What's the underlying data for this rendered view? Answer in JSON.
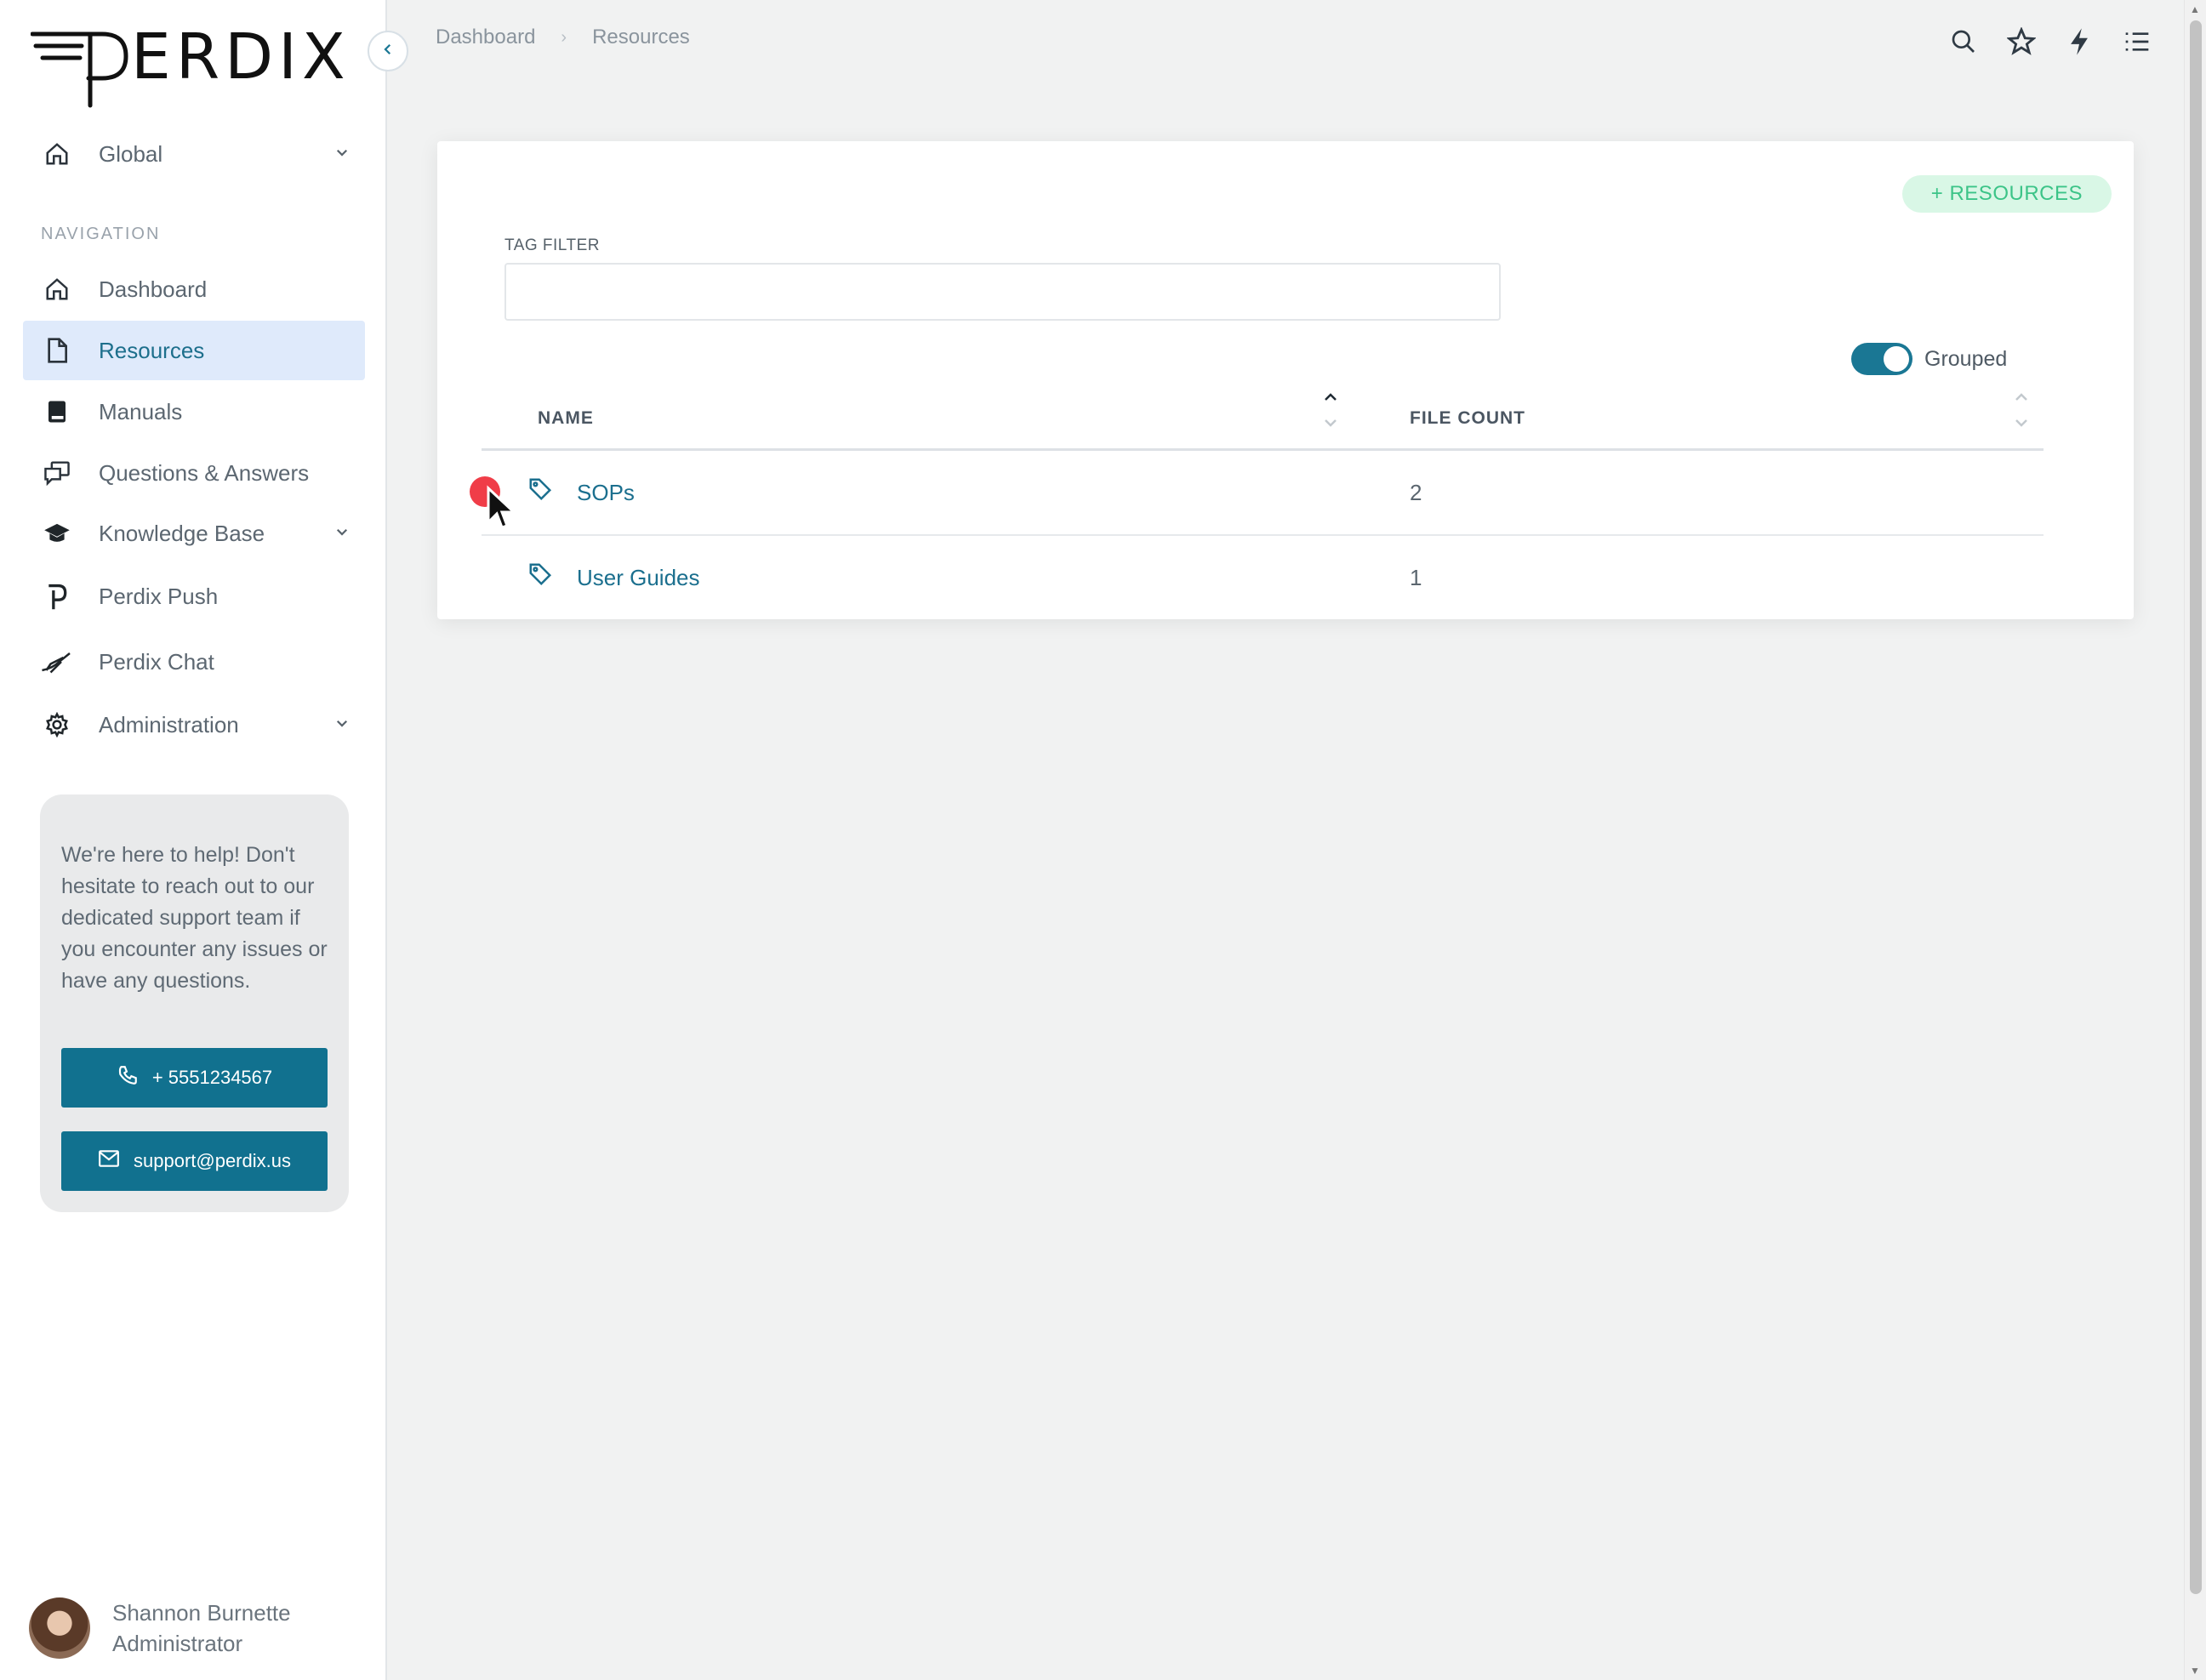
{
  "app": {
    "logo_text": "PERDIX"
  },
  "sidebar": {
    "scope": {
      "label": "Global",
      "icon": "home-icon"
    },
    "nav_heading": "NAVIGATION",
    "items": [
      {
        "label": "Dashboard",
        "icon": "home-icon"
      },
      {
        "label": "Resources",
        "icon": "document-icon",
        "active": true
      },
      {
        "label": "Manuals",
        "icon": "book-icon"
      },
      {
        "label": "Questions & Answers",
        "icon": "chat-icon"
      },
      {
        "label": "Knowledge Base",
        "icon": "graduation-cap-icon",
        "expandable": true
      },
      {
        "label": "Perdix Push",
        "icon": "push-icon"
      },
      {
        "label": "Perdix Chat",
        "icon": "bird-icon"
      },
      {
        "label": "Administration",
        "icon": "gear-icon",
        "expandable": true
      }
    ],
    "help": {
      "text": "We're here to help! Don't hesitate to reach out to our dedicated support team if you encounter any issues or have any questions.",
      "phone": "+ 5551234567",
      "email": "support@perdix.us"
    },
    "user": {
      "name": "Shannon Burnette",
      "role": "Administrator"
    }
  },
  "header": {
    "breadcrumb": [
      "Dashboard",
      "Resources"
    ],
    "icons": [
      "search-icon",
      "star-icon",
      "bolt-icon",
      "list-icon"
    ]
  },
  "main": {
    "add_button": "+ RESOURCES",
    "tag_filter": {
      "label": "TAG FILTER",
      "value": "",
      "placeholder": ""
    },
    "grouped_toggle": {
      "label": "Grouped",
      "on": true
    },
    "table": {
      "columns": [
        "NAME",
        "FILE COUNT"
      ],
      "rows": [
        {
          "name": "SOPs",
          "count": "2"
        },
        {
          "name": "User Guides",
          "count": "1"
        }
      ]
    }
  },
  "colors": {
    "accent": "#11718f",
    "active_nav_bg": "#dfeafb",
    "add_button_bg": "#d9f7e6",
    "add_button_text": "#3cc488",
    "expand_dot": "#f03d48"
  }
}
